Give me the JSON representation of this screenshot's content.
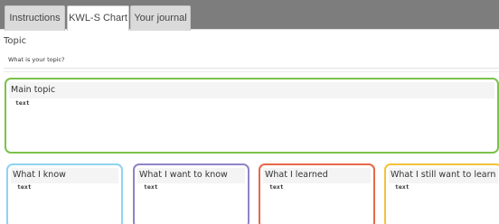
{
  "tabs": [
    {
      "label": "Instructions",
      "active": false
    },
    {
      "label": "KWL-S Chart",
      "active": true
    },
    {
      "label": "Your journal",
      "active": false
    }
  ],
  "topic": {
    "label": "Topic",
    "prompt": "What is your topic?"
  },
  "main_topic": {
    "title": "Main topic",
    "text": "text",
    "border_color": "#7cc24a"
  },
  "columns": [
    {
      "title": "What I know",
      "text": "text",
      "border_color": "#8fd3ef"
    },
    {
      "title": "What I want to know",
      "text": "text",
      "border_color": "#8f84c6"
    },
    {
      "title": "What I learned",
      "text": "text",
      "border_color": "#e8674a"
    },
    {
      "title": "What I still want to learn",
      "text": "text",
      "border_color": "#f2c23a"
    }
  ],
  "colors": {
    "tabbar_bg": "#7d7d7d",
    "tab_inactive_bg": "#dadada",
    "tab_active_bg": "#ffffff"
  }
}
